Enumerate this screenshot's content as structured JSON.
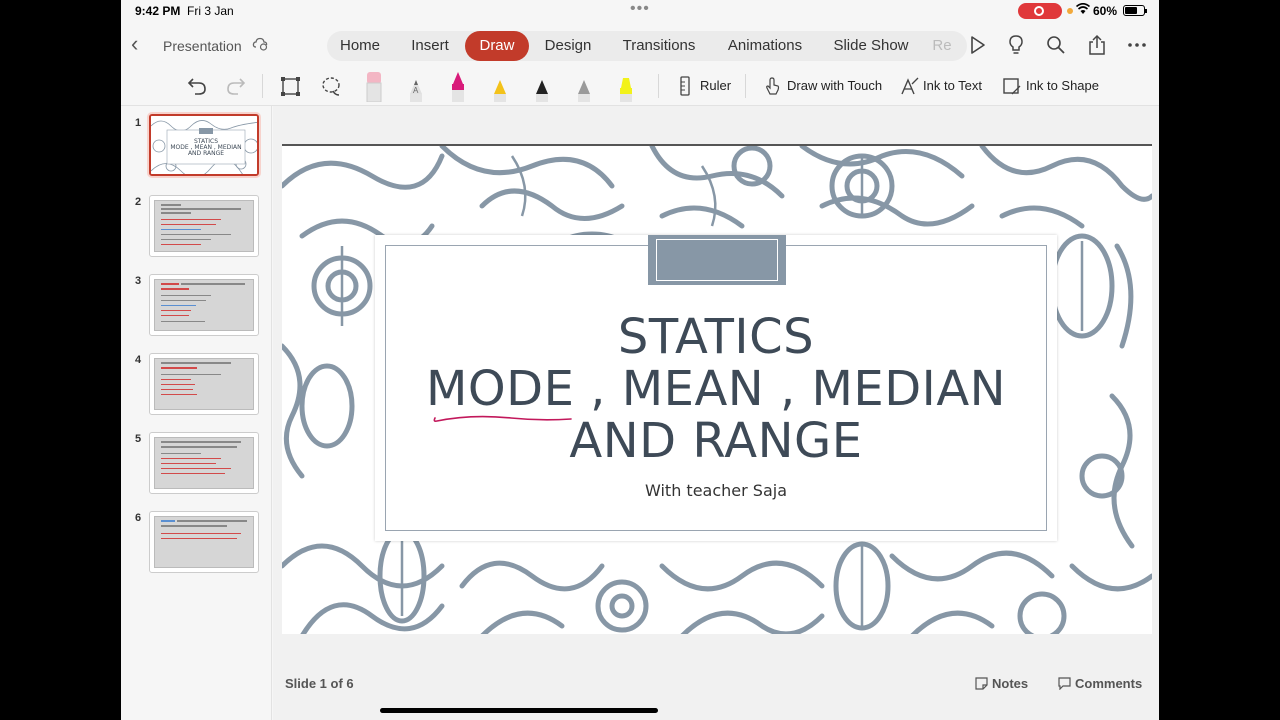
{
  "status": {
    "time": "9:42 PM",
    "date": "Fri 3 Jan",
    "dots": "•••",
    "battery": "60%"
  },
  "doc": {
    "name": "Presentation"
  },
  "tabs": [
    {
      "label": "Home"
    },
    {
      "label": "Insert"
    },
    {
      "label": "Draw",
      "active": true
    },
    {
      "label": "Design"
    },
    {
      "label": "Transitions"
    },
    {
      "label": "Animations"
    },
    {
      "label": "Slide Show"
    },
    {
      "label": "Re"
    }
  ],
  "drawbar": {
    "ruler": "Ruler",
    "draw_touch": "Draw with Touch",
    "ink_text": "Ink to Text",
    "ink_shape": "Ink to Shape",
    "pens": [
      {
        "name": "eraser",
        "color": "#f3b6c4"
      },
      {
        "name": "pencil",
        "color": "#8a8a8a"
      },
      {
        "name": "pen",
        "color": "#d81b7a"
      },
      {
        "name": "pen",
        "color": "#f3c21a"
      },
      {
        "name": "pen",
        "color": "#222222"
      },
      {
        "name": "pen",
        "color": "#9a9a9a"
      },
      {
        "name": "highlighter",
        "color": "#f2f21a"
      }
    ]
  },
  "thumbnails": [
    {
      "num": "1"
    },
    {
      "num": "2"
    },
    {
      "num": "3"
    },
    {
      "num": "4"
    },
    {
      "num": "5"
    },
    {
      "num": "6"
    }
  ],
  "slide": {
    "title_line1": "STATICS",
    "title_line2": "MODE , MEAN , MEDIAN",
    "title_line3": "AND RANGE",
    "subtitle": "With teacher Saja",
    "ink_color": "#c2185b"
  },
  "footer": {
    "slide_count": "Slide 1 of 6",
    "notes": "Notes",
    "comments": "Comments"
  },
  "colors": {
    "accent": "#c23b2a",
    "slide_text": "#3e4a57",
    "pattern": "#8797a6"
  }
}
